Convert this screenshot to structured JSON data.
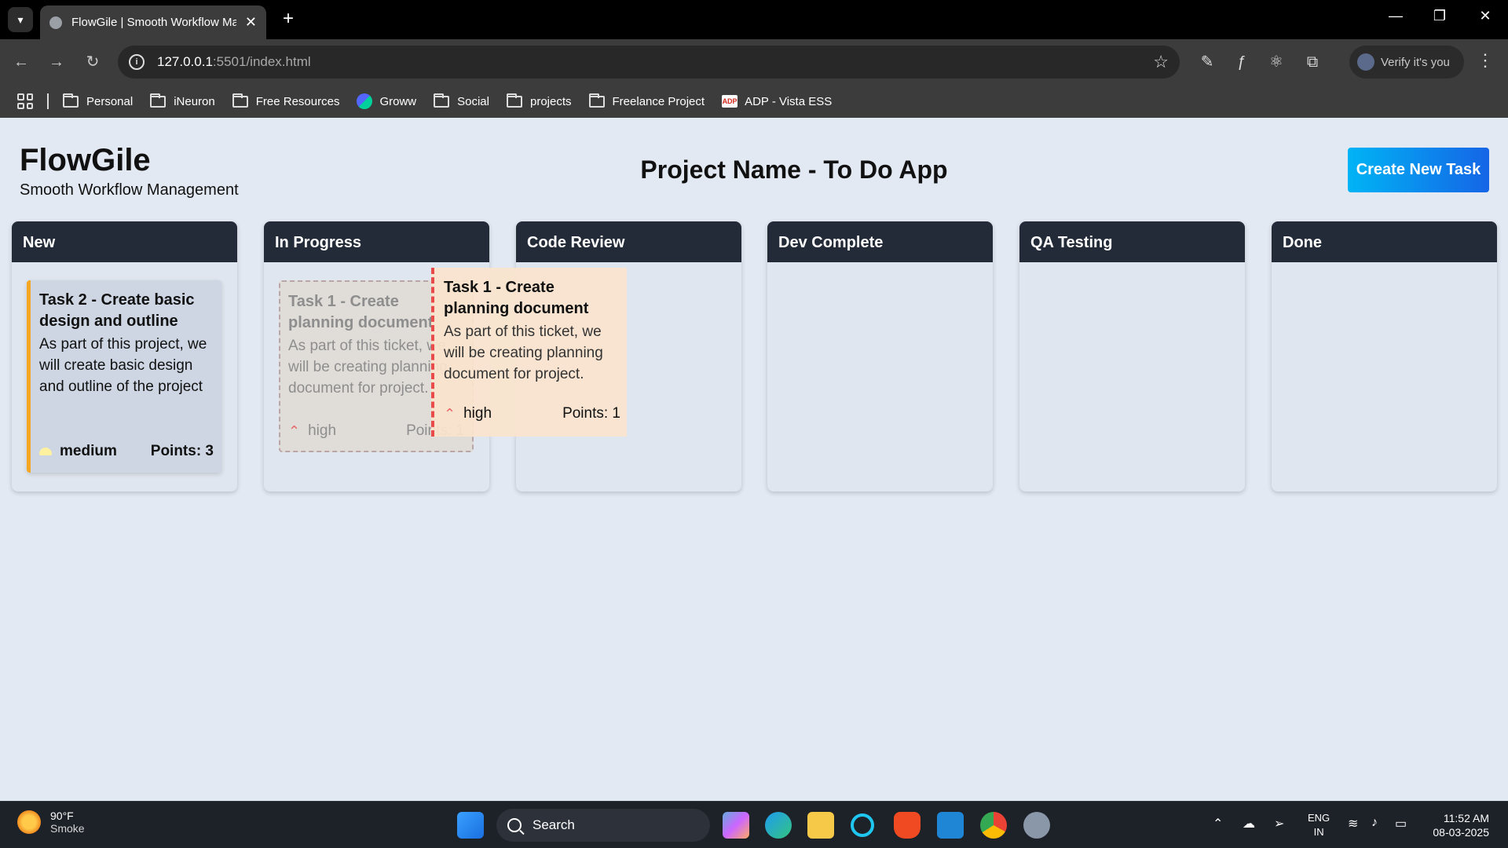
{
  "browser": {
    "tab_title": "FlowGile | Smooth Workflow Management",
    "url_host": "127.0.0.1",
    "url_path": ":5501/index.html",
    "profile_label": "Verify it's you",
    "bookmarks": [
      {
        "label": "Personal",
        "icon": "folder-icon"
      },
      {
        "label": "iNeuron",
        "icon": "folder-icon"
      },
      {
        "label": "Free Resources",
        "icon": "folder-icon"
      },
      {
        "label": "Groww",
        "icon": "groww-icon"
      },
      {
        "label": "Social",
        "icon": "folder-icon"
      },
      {
        "label": "projects",
        "icon": "folder-icon"
      },
      {
        "label": "Freelance Project",
        "icon": "folder-icon"
      },
      {
        "label": "ADP - Vista ESS",
        "icon": "adp-icon"
      }
    ]
  },
  "app": {
    "brand_title": "FlowGile",
    "brand_subtitle": "Smooth Workflow Management",
    "project_name": "Project Name - To Do App",
    "create_button": "Create New Task",
    "columns": [
      "New",
      "In Progress",
      "Code Review",
      "Dev Complete",
      "QA Testing",
      "Done"
    ],
    "tasks": [
      {
        "title": "Task 2 - Create basic design and outline",
        "description": "As part of this project, we will create basic design and outline of the project",
        "priority": "medium",
        "points": "Points: 3",
        "column": "New",
        "accent": "#f5a623"
      },
      {
        "title": "Task 1 - Create planning document",
        "description": "As part of this ticket, we will be creating planning document for project.",
        "priority": "high",
        "points": "Points: 1",
        "column": "In Progress",
        "accent": "#e94b4b",
        "state": "dragging"
      }
    ]
  },
  "taskbar": {
    "weather_temp": "90°F",
    "weather_desc": "Smoke",
    "search_label": "Search",
    "lang_line1": "ENG",
    "lang_line2": "IN",
    "time": "11:52 AM",
    "date": "08-03-2025"
  }
}
